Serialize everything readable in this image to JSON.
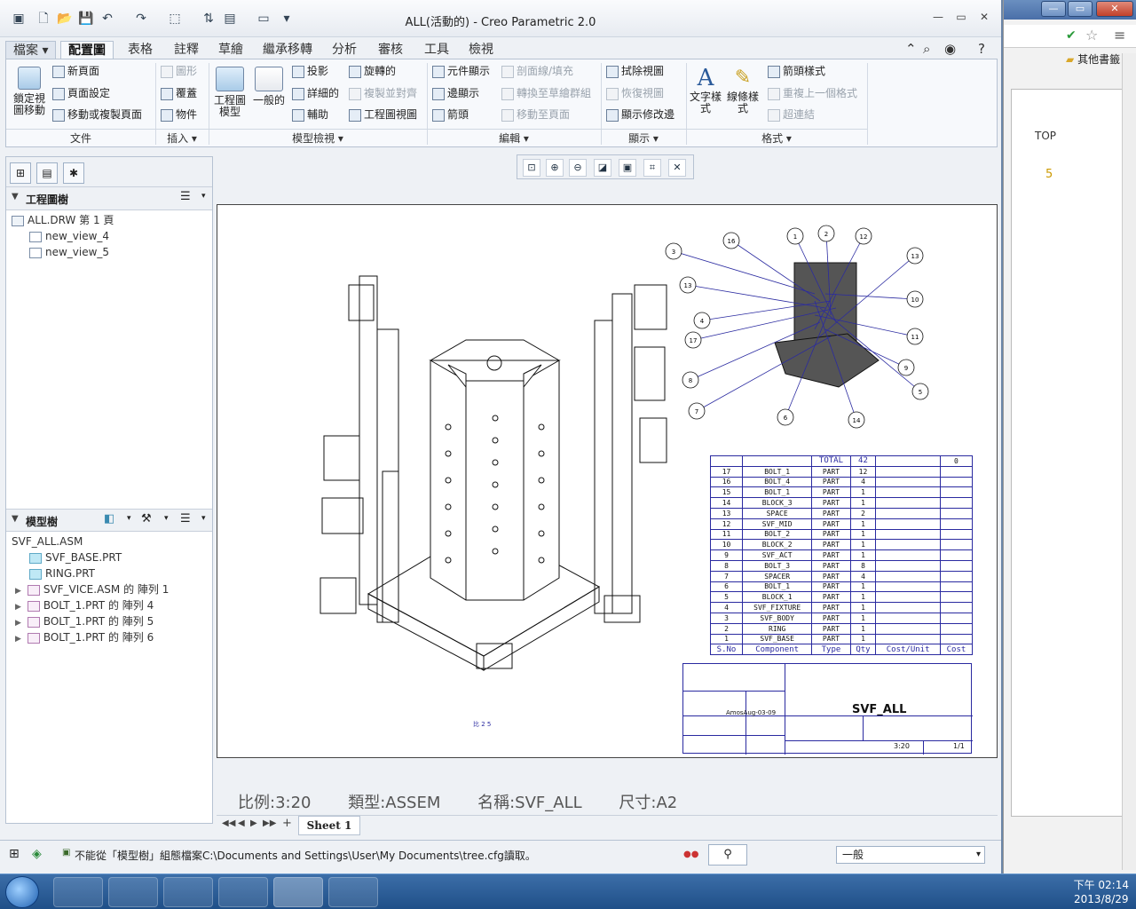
{
  "window": {
    "title": "ALL(活動的) - Creo Parametric 2.0"
  },
  "tabs": [
    {
      "label": "檔案"
    },
    {
      "label": "配置圖"
    },
    {
      "label": "表格"
    },
    {
      "label": "註釋"
    },
    {
      "label": "草繪"
    },
    {
      "label": "繼承移轉"
    },
    {
      "label": "分析"
    },
    {
      "label": "審核"
    },
    {
      "label": "工具"
    },
    {
      "label": "檢視"
    }
  ],
  "ribbon": {
    "file_group": {
      "lock_move": "鎖定視\n圖移動",
      "new_page": "新頁面",
      "page_setup": "頁面設定",
      "move_copy_page": "移動或複製頁面",
      "label": "文件"
    },
    "insert_group": {
      "graph": "圖形",
      "overlay": "覆蓋",
      "object": "物件",
      "label": "插入"
    },
    "model_views_group": {
      "drawing_model": "工程圖\n模型",
      "general": "一般的",
      "projection": "投影",
      "detailed": "詳細的",
      "auxiliary": "輔助",
      "revolved": "旋轉的",
      "copy_align": "複製並對齊",
      "drawing_view": "工程圖視圖",
      "label": "模型檢視"
    },
    "edit_group": {
      "component_display": "元件顯示",
      "section_hatch": "剖面線/填充",
      "edge_display": "邊顯示",
      "convert_group": "轉換至草繪群組",
      "arrow": "箭頭",
      "move_to_page": "移動至頁面",
      "label": "編輯"
    },
    "display_group": {
      "erase_view": "拭除視圖",
      "resume_view": "恢復視圖",
      "show_modify": "顯示修改邊",
      "label": "顯示"
    },
    "format_group": {
      "text_style": "文字樣\n式",
      "line_style": "線條樣\n式",
      "arrow_style": "箭頭樣式",
      "repeat_format": "重複上一個格式",
      "hyperlink": "超連結",
      "label": "格式"
    }
  },
  "left_panel": {
    "drawing_tree_title": "工程圖樹",
    "drawing_tree": [
      "ALL.DRW 第 1 頁",
      "new_view_4",
      "new_view_5"
    ],
    "model_tree_title": "模型樹",
    "model_tree": [
      {
        "label": "SVF_ALL.ASM"
      },
      {
        "label": "SVF_BASE.PRT"
      },
      {
        "label": "RING.PRT"
      },
      {
        "label": "SVF_VICE.ASM 的 陣列 1"
      },
      {
        "label": "BOLT_1.PRT 的 陣列 4"
      },
      {
        "label": "BOLT_1.PRT 的 陣列 5"
      },
      {
        "label": "BOLT_1.PRT 的 陣列 6"
      }
    ]
  },
  "drawing": {
    "bom_header": {
      "total": "TOTAL",
      "total_qty": "42",
      "cost_total": "0"
    },
    "bom_rows": [
      [
        "17",
        "BOLT_1",
        "PART",
        "12"
      ],
      [
        "16",
        "BOLT_4",
        "PART",
        "4"
      ],
      [
        "15",
        "BOLT_1",
        "PART",
        "1"
      ],
      [
        "14",
        "BLOCK_3",
        "PART",
        "1"
      ],
      [
        "13",
        "SPACE",
        "PART",
        "2"
      ],
      [
        "12",
        "SVF_MID",
        "PART",
        "1"
      ],
      [
        "11",
        "BOLT_2",
        "PART",
        "1"
      ],
      [
        "10",
        "BLOCK_2",
        "PART",
        "1"
      ],
      [
        "9",
        "SVF_ACT",
        "PART",
        "1"
      ],
      [
        "8",
        "BOLT_3",
        "PART",
        "8"
      ],
      [
        "7",
        "SPACER",
        "PART",
        "4"
      ],
      [
        "6",
        "BOLT_1",
        "PART",
        "1"
      ],
      [
        "5",
        "BLOCK_1",
        "PART",
        "1"
      ],
      [
        "4",
        "SVF_FIXTURE",
        "PART",
        "1"
      ],
      [
        "3",
        "SVF_BODY",
        "PART",
        "1"
      ],
      [
        "2",
        "RING",
        "PART",
        "1"
      ],
      [
        "1",
        "SVF_BASE",
        "PART",
        "1"
      ]
    ],
    "bom_columns": [
      "S.No",
      "Component",
      "Type",
      "Qty",
      "Cost/Unit",
      "Cost"
    ],
    "title_block": {
      "name": "SVF_ALL",
      "author": "AmosAug-03-09",
      "scale": "3:20",
      "page": "1/1"
    },
    "view_scale_text": "比 2 5",
    "balloons": [
      "3",
      "16",
      "13",
      "2",
      "1",
      "12",
      "13",
      "10",
      "4",
      "17",
      "11",
      "8",
      "9",
      "7",
      "6",
      "14",
      "5"
    ]
  },
  "status": {
    "scale": "比例:3:20",
    "type": "類型:ASSEM",
    "name": "名稱:SVF_ALL",
    "size": "尺寸:A2"
  },
  "sheet": {
    "tab": "Sheet 1"
  },
  "message": {
    "text": "不能從「模型樹」組態檔案C:\\Documents and Settings\\User\\My Documents\\tree.cfg讀取。",
    "filter": "一般"
  },
  "browser": {
    "top_label": "TOP",
    "bookmarks": "其他書籤",
    "number": "5"
  },
  "taskbar": {
    "time": "下午 02:14",
    "date": "2013/8/29"
  }
}
